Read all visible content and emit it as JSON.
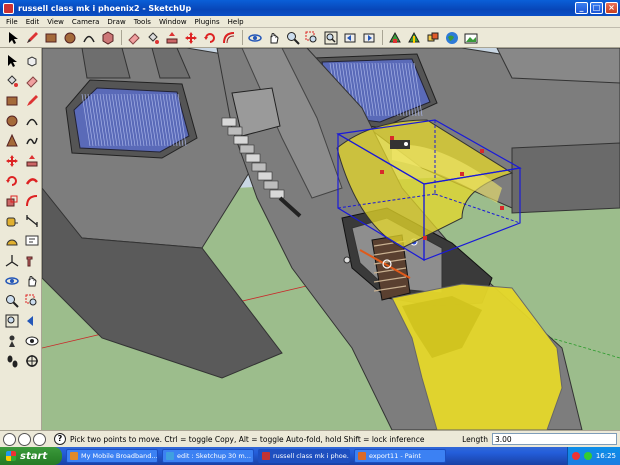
{
  "window": {
    "title": "russell class mk i phoenix2 - SketchUp",
    "minimize": "_",
    "maximize": "□",
    "close": "×"
  },
  "menu": [
    "File",
    "Edit",
    "View",
    "Camera",
    "Draw",
    "Tools",
    "Window",
    "Plugins",
    "Help"
  ],
  "toolbar_icons": [
    "select-icon",
    "pencil-icon",
    "rectangle-icon",
    "circle-icon",
    "arc-icon",
    "polygon-icon",
    "eraser-icon",
    "paint-bucket-icon",
    "push-pull-icon",
    "move-icon",
    "rotate-icon",
    "offset-icon",
    "orbit-icon",
    "pan-icon",
    "zoom-icon",
    "zoom-window-icon",
    "zoom-extents-icon",
    "previous-view-icon",
    "next-view-icon",
    "get-models-icon",
    "share-model-icon",
    "components-icon",
    "google-earth-icon",
    "photo-textures-icon"
  ],
  "palette_icons": [
    "select-icon",
    "make-component-icon",
    "paint-bucket-icon",
    "eraser-icon",
    "rectangle-icon",
    "line-icon",
    "circle-icon",
    "arc-icon",
    "polygon-icon",
    "freehand-icon",
    "move-icon",
    "push-pull-icon",
    "rotate-icon",
    "follow-me-icon",
    "scale-icon",
    "offset-icon",
    "tape-measure-icon",
    "dimension-icon",
    "protractor-icon",
    "text-icon",
    "axes-icon",
    "3d-text-icon",
    "orbit-icon",
    "pan-icon",
    "zoom-icon",
    "zoom-window-icon",
    "zoom-extents-icon",
    "previous-icon",
    "position-camera-icon",
    "look-around-icon",
    "walk-icon",
    "section-plane-icon"
  ],
  "status": {
    "hint": "Pick two points to move.  Ctrl = toggle Copy, Alt = toggle Auto-fold, hold Shift = lock inference",
    "vcb_label": "Length",
    "vcb_value": "3.00"
  },
  "taskbar": {
    "start": "start",
    "tasks": [
      {
        "label": "My Mobile Broadband...",
        "color": "#e08a2a"
      },
      {
        "label": "edit : Sketchup 30 m...",
        "color": "#3fa0e0"
      },
      {
        "label": "russell class mk i phoe...",
        "color": "#c33333"
      },
      {
        "label": "export11 - Paint",
        "color": "#d86a2a"
      }
    ],
    "clock": "16:25"
  },
  "colors": {
    "ground": "#9cbd8c",
    "sky": "#c9d7e4",
    "hull": "#7d7d7d",
    "hull_dark": "#5a5a5a",
    "canopy": "#e6d82a",
    "selection": "#1a1ad8",
    "solar": "#5a6ab8"
  }
}
